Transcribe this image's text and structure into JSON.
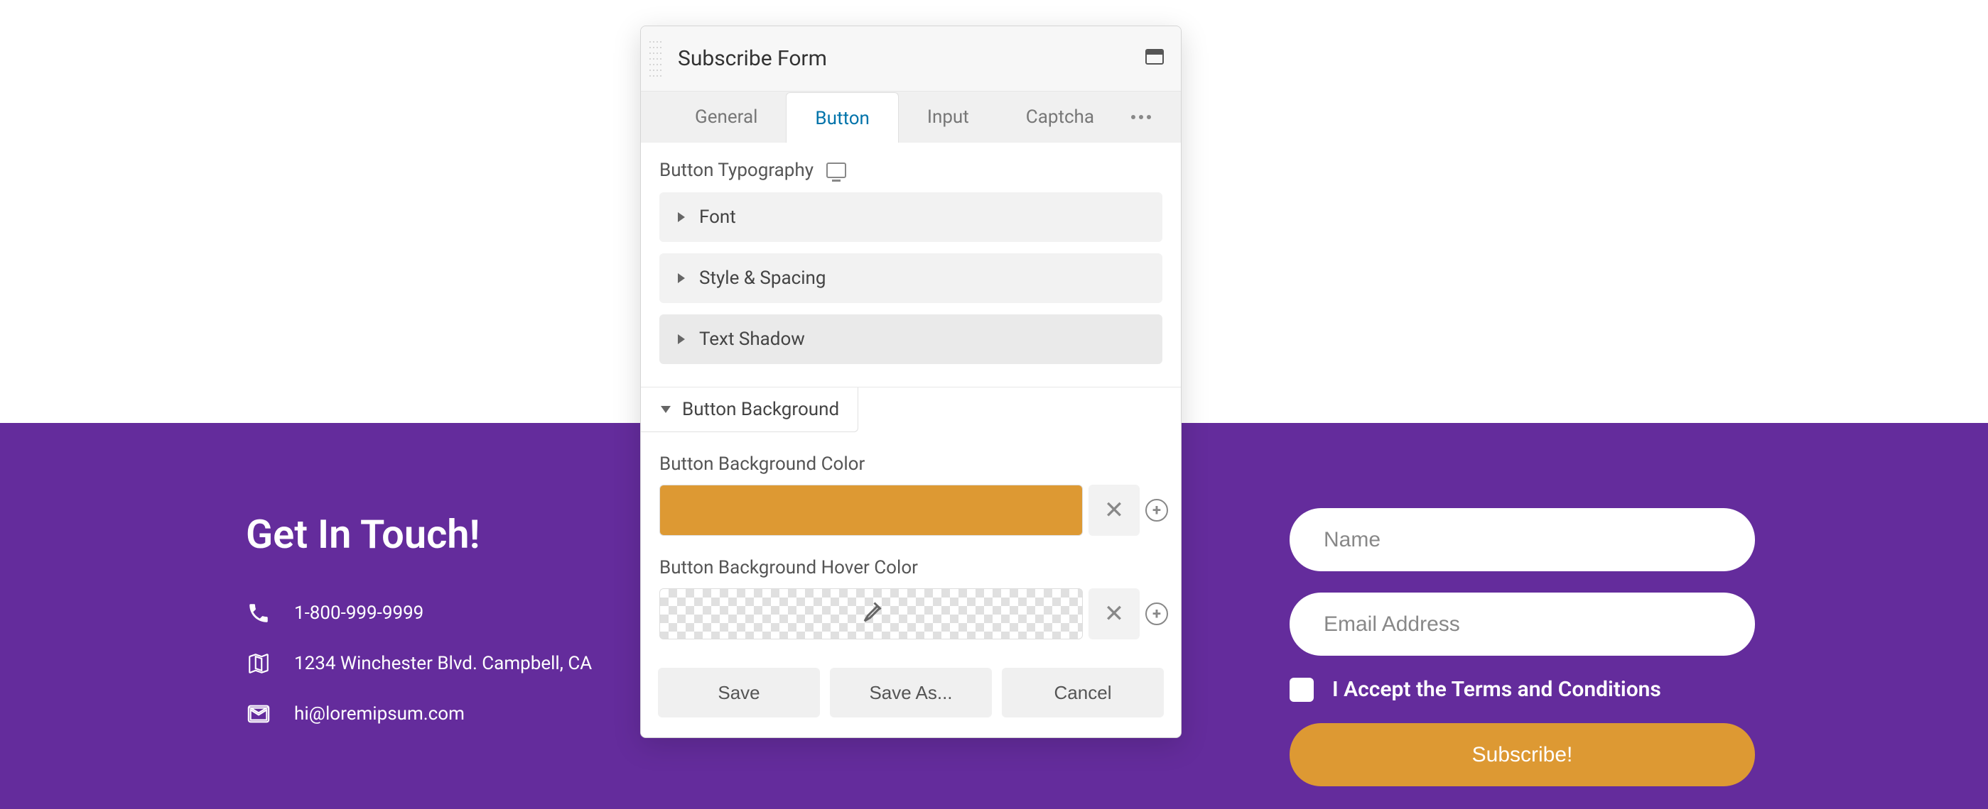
{
  "footer": {
    "title": "Get In Touch!",
    "phone": "1-800-999-9999",
    "address": "1234 Winchester Blvd. Campbell, CA",
    "email": "hi@loremipsum.com"
  },
  "form": {
    "name_placeholder": "Name",
    "email_placeholder": "Email Address",
    "terms_text": "I Accept the Terms and Conditions",
    "submit_label": "Subscribe!"
  },
  "editor": {
    "title": "Subscribe Form",
    "tabs": {
      "general": "General",
      "button": "Button",
      "input": "Input",
      "captcha": "Captcha"
    },
    "sections": {
      "typography_label": "Button Typography",
      "font": "Font",
      "style_spacing": "Style & Spacing",
      "text_shadow": "Text Shadow",
      "background_header": "Button Background",
      "bg_color_label": "Button Background Color",
      "bg_hover_label": "Button Background Hover Color"
    },
    "colors": {
      "bg_color": "#dd9933",
      "bg_hover": "transparent"
    },
    "buttons": {
      "save": "Save",
      "save_as": "Save As...",
      "cancel": "Cancel"
    }
  }
}
